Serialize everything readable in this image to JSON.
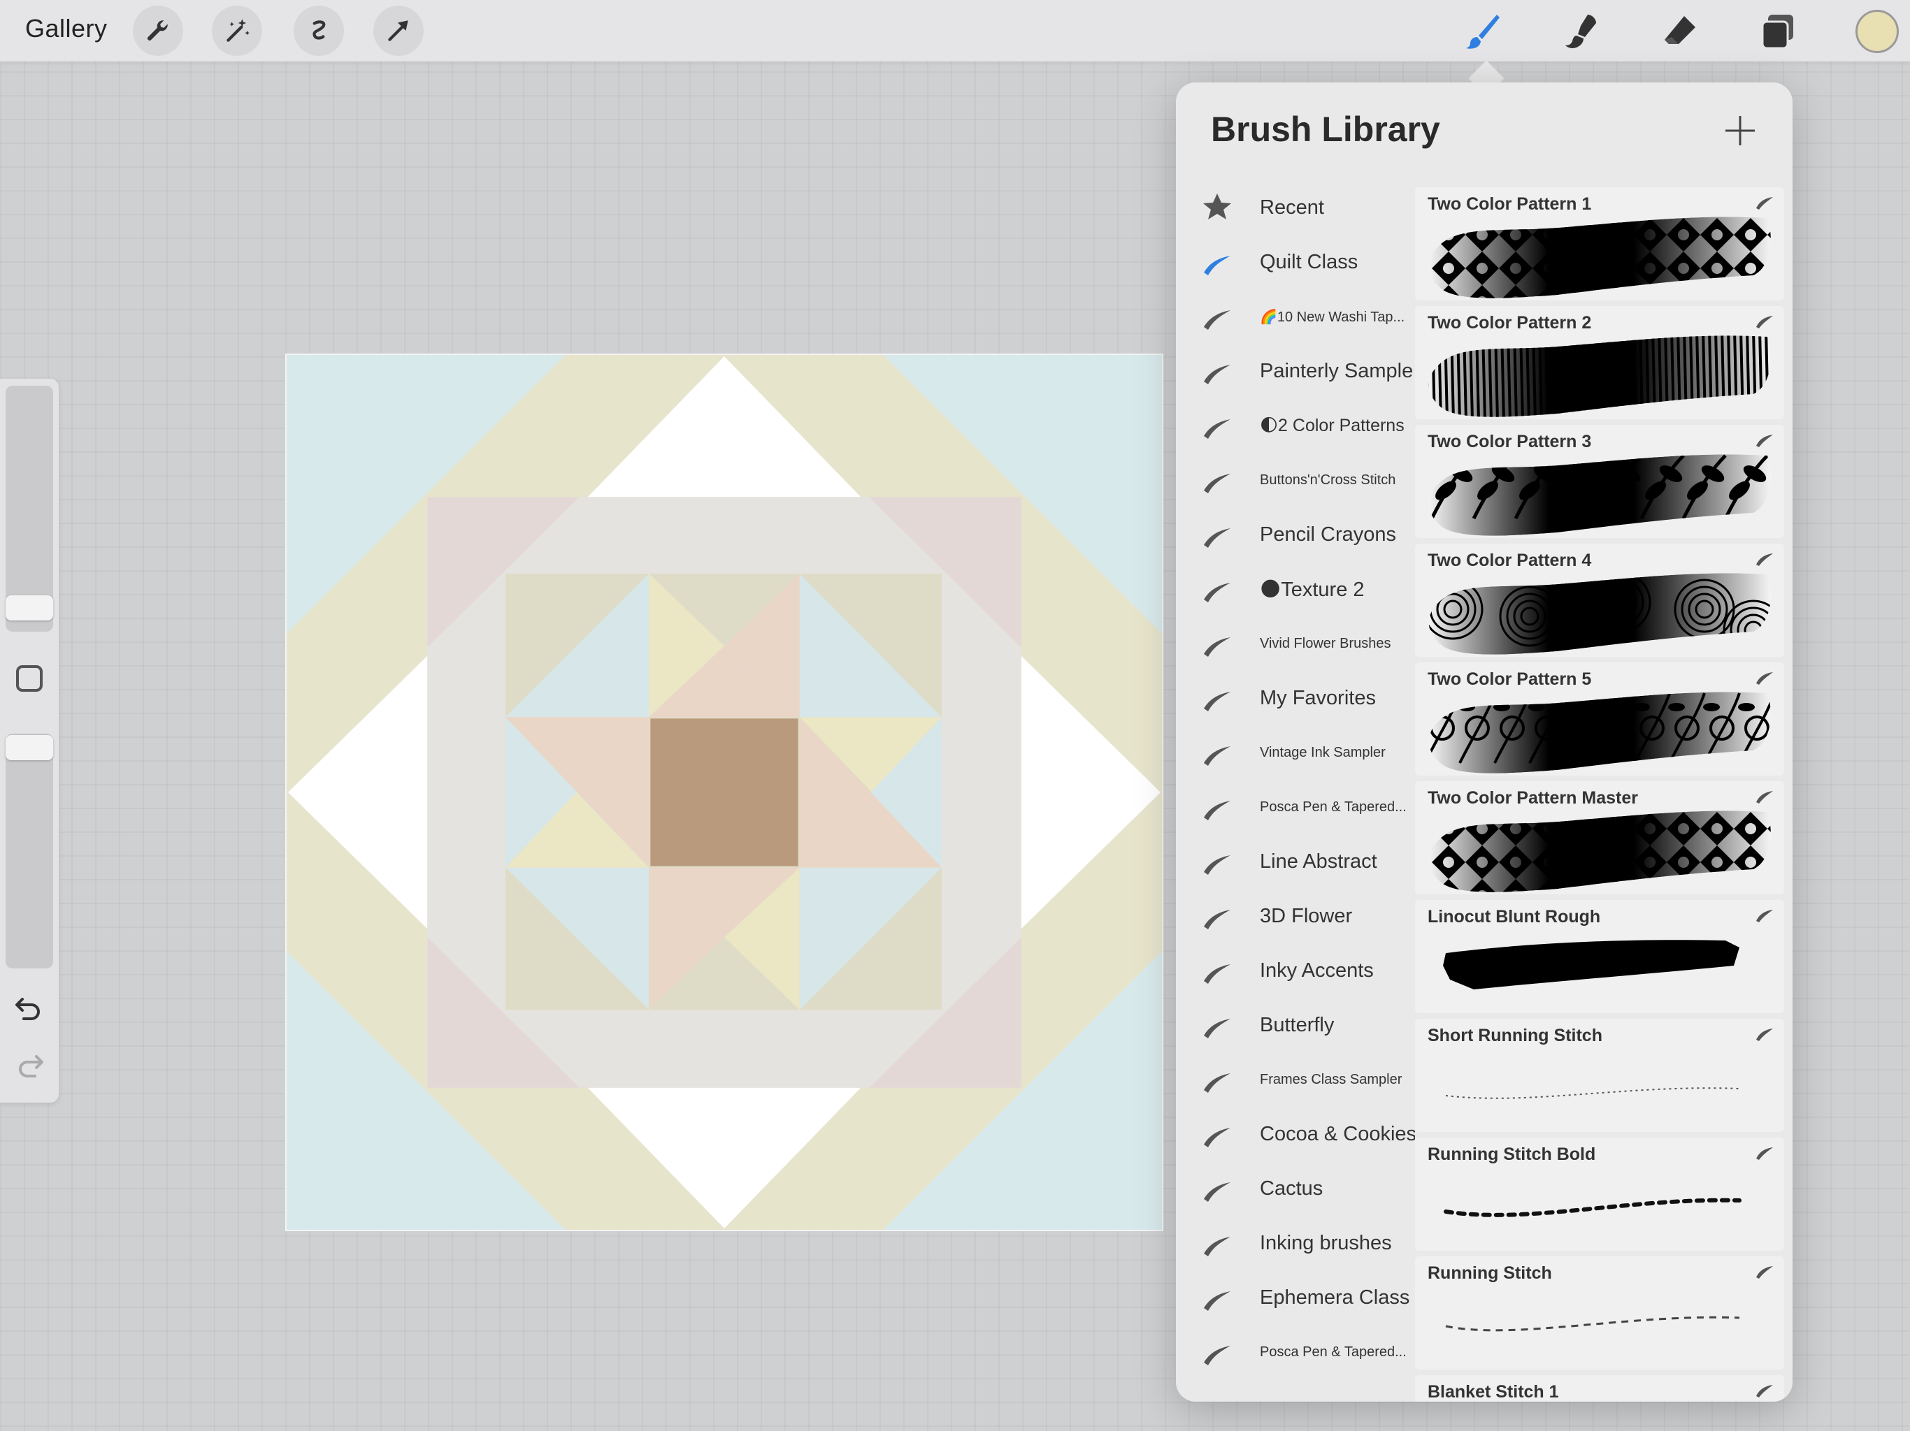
{
  "topbar": {
    "gallery_label": "Gallery",
    "left_tools": [
      "wrench-icon",
      "magic-wand-icon",
      "selection-icon",
      "transform-arrow-icon"
    ],
    "right_tools": [
      "paintbrush-icon",
      "smudge-icon",
      "eraser-icon",
      "layers-icon"
    ],
    "active_tool_color": "#2f7fe0",
    "current_color": "#e8dfb2"
  },
  "sidebar": {
    "icons": [
      "modify-square-icon",
      "undo-icon",
      "redo-icon"
    ]
  },
  "brush_library": {
    "title": "Brush Library",
    "sets": [
      {
        "label": "Recent",
        "icon": "star-icon",
        "size": "big"
      },
      {
        "label": "Quilt Class",
        "icon": "brush-stroke-icon",
        "size": "big",
        "active": true
      },
      {
        "label": "🌈10 New Washi Tap...",
        "icon": "brush-stroke-icon",
        "size": "small"
      },
      {
        "label": "Painterly Sample",
        "icon": "brush-stroke-icon",
        "size": "big"
      },
      {
        "label": "🌓2 Color Patterns",
        "icon": "brush-stroke-icon",
        "size": "mid"
      },
      {
        "label": "Buttons'n'Cross Stitch",
        "icon": "brush-stroke-icon",
        "size": "small"
      },
      {
        "label": "Pencil Crayons",
        "icon": "brush-stroke-icon",
        "size": "big"
      },
      {
        "label": "🌑Texture 2",
        "icon": "brush-stroke-icon",
        "size": "big"
      },
      {
        "label": "Vivid Flower Brushes",
        "icon": "brush-stroke-icon",
        "size": "small"
      },
      {
        "label": "My Favorites",
        "icon": "brush-stroke-icon",
        "size": "big"
      },
      {
        "label": "Vintage Ink Sampler",
        "icon": "brush-stroke-icon",
        "size": "small"
      },
      {
        "label": "Posca Pen & Tapered...",
        "icon": "brush-stroke-icon",
        "size": "small"
      },
      {
        "label": "Line Abstract",
        "icon": "brush-stroke-icon",
        "size": "big"
      },
      {
        "label": "3D Flower",
        "icon": "brush-stroke-icon",
        "size": "big"
      },
      {
        "label": "Inky Accents",
        "icon": "brush-stroke-icon",
        "size": "big"
      },
      {
        "label": "Butterfly",
        "icon": "brush-stroke-icon",
        "size": "big"
      },
      {
        "label": "Frames Class Sampler",
        "icon": "brush-stroke-icon",
        "size": "small"
      },
      {
        "label": "Cocoa & Cookies",
        "icon": "brush-stroke-icon",
        "size": "big"
      },
      {
        "label": "Cactus",
        "icon": "brush-stroke-icon",
        "size": "big"
      },
      {
        "label": "Inking brushes",
        "icon": "brush-stroke-icon",
        "size": "big"
      },
      {
        "label": "Ephemera Class",
        "icon": "brush-stroke-icon",
        "size": "big"
      },
      {
        "label": "Posca Pen & Tapered...",
        "icon": "brush-stroke-icon",
        "size": "small"
      }
    ],
    "brushes": [
      {
        "name": "Two Color Pattern 1",
        "preview": "pattern-tiles"
      },
      {
        "name": "Two Color Pattern 2",
        "preview": "pattern-lines"
      },
      {
        "name": "Two Color Pattern 3",
        "preview": "pattern-leaves"
      },
      {
        "name": "Two Color Pattern 4",
        "preview": "pattern-circles"
      },
      {
        "name": "Two Color Pattern 5",
        "preview": "pattern-roses"
      },
      {
        "name": "Two Color Pattern Master",
        "preview": "pattern-tiles"
      },
      {
        "name": "Linocut Blunt Rough",
        "preview": "solid-blunt"
      },
      {
        "name": "Short Running Stitch",
        "preview": "dotted-thin"
      },
      {
        "name": "Running Stitch Bold",
        "preview": "dashed-bold"
      },
      {
        "name": "Running Stitch",
        "preview": "dashed-thin"
      },
      {
        "name": "Blanket Stitch 1",
        "preview": "none"
      }
    ]
  }
}
